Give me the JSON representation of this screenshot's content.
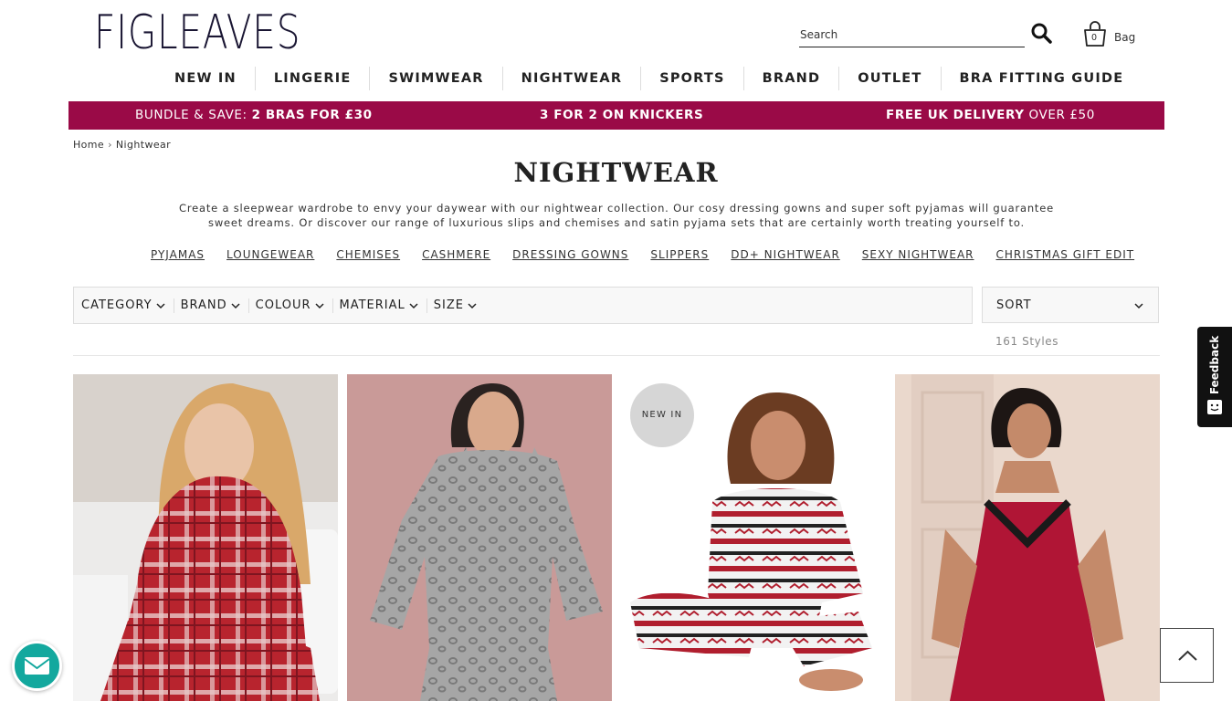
{
  "header": {
    "logo_text": "FIGLEAVES",
    "search_placeholder": "Search",
    "bag_label": "Bag",
    "bag_count": "0"
  },
  "nav": {
    "items": [
      "NEW IN",
      "LINGERIE",
      "SWIMWEAR",
      "NIGHTWEAR",
      "SPORTS",
      "BRAND",
      "OUTLET",
      "BRA FITTING GUIDE"
    ]
  },
  "promo": {
    "left_prefix": "BUNDLE & SAVE: ",
    "left_bold": "2 BRAS FOR £30",
    "center_bold": "3 FOR 2 ON KNICKERS",
    "right_bold": "FREE UK DELIVERY",
    "right_suffix": " OVER £50",
    "background": "#9a0a47"
  },
  "breadcrumb": {
    "home": "Home",
    "separator": "›",
    "current": "Nightwear"
  },
  "page": {
    "title": "NIGHTWEAR",
    "intro": "Create a sleepwear wardrobe to envy your daywear with our nightwear collection. Our cosy dressing gowns and super soft pyjamas will guarantee sweet dreams. Or discover our range of luxurious slips and chemises and satin pyjama sets that are certainly worth treating yourself to."
  },
  "subcategories": [
    "PYJAMAS",
    "LOUNGEWEAR",
    "CHEMISES",
    "CASHMERE",
    "DRESSING GOWNS",
    "SLIPPERS",
    "DD+ NIGHTWEAR",
    "SEXY NIGHTWEAR",
    "CHRISTMAS GIFT EDIT"
  ],
  "filters": {
    "items": [
      "CATEGORY",
      "BRAND",
      "COLOUR",
      "MATERIAL",
      "SIZE"
    ],
    "sort_label": "SORT",
    "styles_count": "161 Styles"
  },
  "products": [
    {
      "image": "red-check-pyjamas",
      "badge": ""
    },
    {
      "image": "grey-leopard-loungewear",
      "badge": ""
    },
    {
      "image": "fair-isle-pyjamas",
      "badge": "NEW IN"
    },
    {
      "image": "red-satin-chemise",
      "badge": ""
    }
  ],
  "widgets": {
    "feedback_label": "Feedback",
    "chat_color": "#13a89e"
  }
}
